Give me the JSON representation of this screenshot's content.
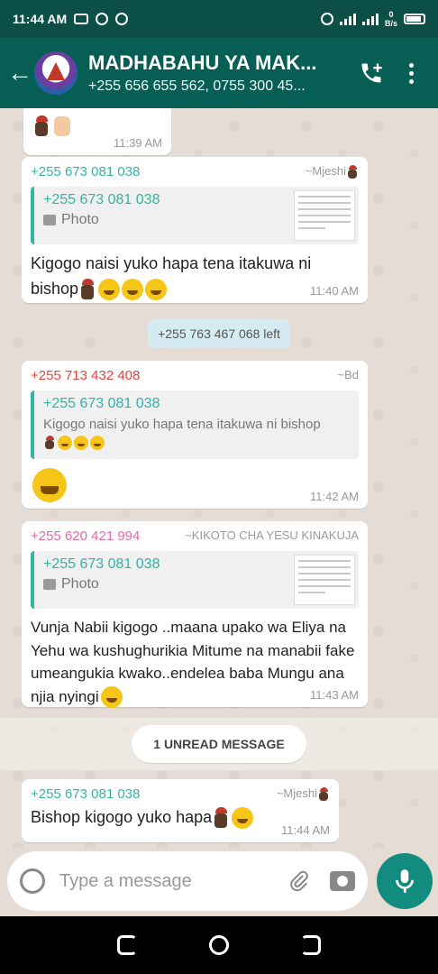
{
  "status_bar": {
    "time": "11:44 AM",
    "net_speed": "0\nB/s"
  },
  "header": {
    "title": "MADHABAHU YA MAK...",
    "subtitle": "+255 656 655 562, 0755 300 45..."
  },
  "messages": [
    {
      "time": "11:39 AM"
    },
    {
      "sender": "+255 673 081 038",
      "alias": "~Mjeshi",
      "quote_sender": "+255 673 081 038",
      "quote_text": "Photo",
      "text": "Kigogo naisi yuko hapa tena itakuwa ni bishop",
      "time": "11:40 AM"
    },
    {
      "system": "+255 763 467 068 left"
    },
    {
      "sender": "+255 713 432 408",
      "alias": "~Bd",
      "quote_sender": "+255 673 081 038",
      "quote_text": "Kigogo naisi yuko hapa tena itakuwa ni bishop",
      "time": "11:42 AM"
    },
    {
      "sender": "+255 620 421 994",
      "alias": "~KIKOTO CHA YESU KINAKUJA",
      "quote_sender": "+255 673 081 038",
      "quote_text": "Photo",
      "text": "Vunja Nabii kigogo ..maana upako wa Eliya na Yehu wa kushughurikia Mitume na manabii fake umeangukia kwako..endelea baba Mungu ana njia nyingi",
      "time": "11:43 AM"
    },
    {
      "unread": "1 UNREAD MESSAGE"
    },
    {
      "sender": "+255 673 081 038",
      "alias": "~Mjeshi",
      "text": "Bishop kigogo yuko hapa",
      "time": "11:44 AM"
    }
  ],
  "input": {
    "placeholder": "Type a message"
  },
  "colors": {
    "header": "#075e54",
    "accent": "#128c7e",
    "chat_bg": "#e5ddd5"
  }
}
